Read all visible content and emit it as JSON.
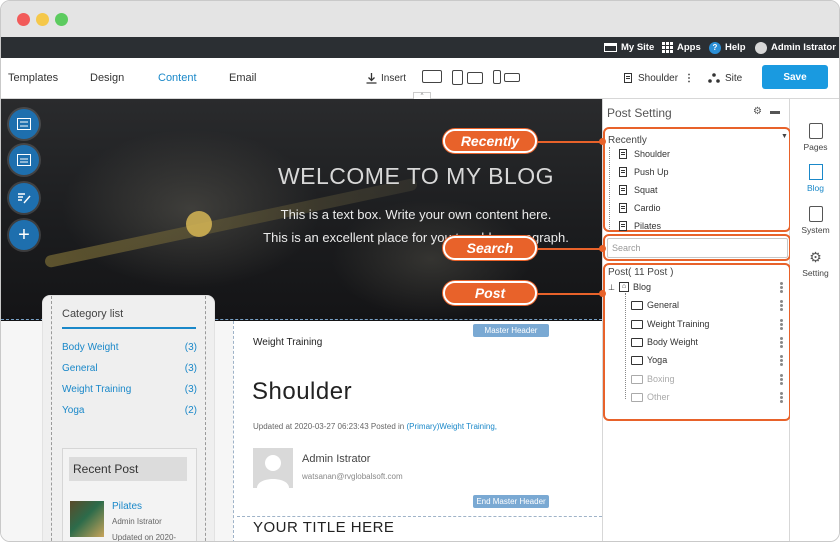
{
  "topbar": {
    "my_site": "My Site",
    "apps": "Apps",
    "help": "Help",
    "user": "Admin Istrator"
  },
  "toolbar": {
    "tabs": [
      "Templates",
      "Design",
      "Content",
      "Email"
    ],
    "active_tab": "Content",
    "insert": "Insert",
    "page_name": "Shoulder",
    "site": "Site",
    "save": "Save"
  },
  "hero": {
    "title": "WELCOME TO MY BLOG",
    "line1": "This is a text box. Write your own content here.",
    "line2": "This is an excellent place for you to add a paragraph."
  },
  "category_list": {
    "title": "Category list",
    "items": [
      {
        "name": "Body Weight",
        "count": "(3)"
      },
      {
        "name": "General",
        "count": "(3)"
      },
      {
        "name": "Weight Training",
        "count": "(3)"
      },
      {
        "name": "Yoga",
        "count": "(2)"
      }
    ],
    "recent_title": "Recent Post",
    "recent_item": "Pilates",
    "recent_author": "Admin Istrator",
    "recent_updated": "Updated on 2020-"
  },
  "post": {
    "master_header": "Master Header",
    "end_master_header": "End Master Header",
    "category": "Weight Training",
    "title": "Shoulder",
    "meta_prefix": "Updated at 2020-03-27 06:23:43 Posted in",
    "meta_link": "(Primary)Weight Training,",
    "author": "Admin Istrator",
    "author_email": "watsanan@rvglobalsoft.com",
    "your_title": "YOUR TITLE HERE"
  },
  "post_setting": {
    "title": "Post Setting",
    "recently_label": "Recently",
    "recently": [
      "Shoulder",
      "Push Up",
      "Squat",
      "Cardio",
      "Pilates"
    ],
    "search_placeholder": "Search",
    "post_header": "Post( 11 Post )",
    "root": "Blog",
    "folders": [
      {
        "name": "General",
        "dim": false
      },
      {
        "name": "Weight Training",
        "dim": false
      },
      {
        "name": "Body Weight",
        "dim": false
      },
      {
        "name": "Yoga",
        "dim": false
      },
      {
        "name": "Boxing",
        "dim": true
      },
      {
        "name": "Other",
        "dim": true
      }
    ]
  },
  "rail": {
    "items": [
      "Pages",
      "Blog",
      "System",
      "Setting"
    ],
    "active": "Blog"
  },
  "callouts": {
    "recently": "Recently",
    "search": "Search",
    "post": "Post"
  },
  "colors": {
    "accent": "#1a88c9",
    "save": "#1a9ae0",
    "callout": "#e8622a",
    "topbar": "#2b2f33"
  }
}
